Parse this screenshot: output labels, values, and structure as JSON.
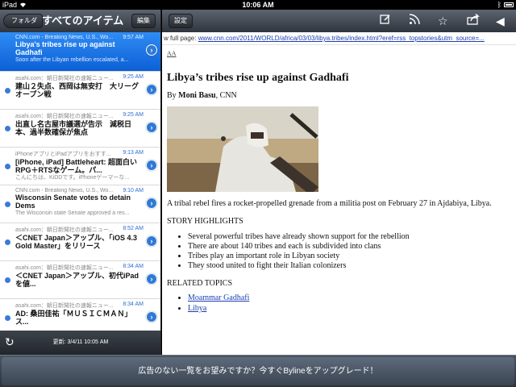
{
  "status_bar": {
    "carrier": "iPad",
    "time": "10:06 AM"
  },
  "left_pane": {
    "folder_button": "フォルダ",
    "title": "すべてのアイテム",
    "edit_button": "編集",
    "items": [
      {
        "source": "CNN.com - Breaking News, U.S., Wo...",
        "time": "9:57 AM",
        "title": "Libya's tribes rise up against Gadhafi",
        "snippet": "Soon after the Libyan rebellion escalated, a...",
        "selected": true
      },
      {
        "source": "asahi.com：朝日新聞社の速報ニュー...",
        "time": "9:25 AM",
        "title": "建山２失点、西岡は無安打　大リーグオープン戦",
        "snippet": ""
      },
      {
        "source": "asahi.com：朝日新聞社の速報ニュー...",
        "time": "9:25 AM",
        "title": "出直し名古屋市議選が告示　減税日本、過半数確保が焦点",
        "snippet": ""
      },
      {
        "source": "iPhoneアプリとiPadアプリをおすす...",
        "time": "9:13 AM",
        "title": "[iPhone, iPad] Battleheart: 超面白いRPG＋RTSなゲーム。パ...",
        "snippet": "こんにちは、KiDDです。iPhoneゲーマーな..."
      },
      {
        "source": "CNN.com - Breaking News, U.S., Wo...",
        "time": "9:10 AM",
        "title": "Wisconsin Senate votes to detain Dems",
        "snippet": "The Wisconsin state Senate approved a res..."
      },
      {
        "source": "asahi.com：朝日新聞社の速報ニュー...",
        "time": "8:52 AM",
        "title": "＜CNET Japan＞アップル、「iOS 4.3 Gold Master」をリリース",
        "snippet": ""
      },
      {
        "source": "asahi.com：朝日新聞社の速報ニュー...",
        "time": "8:34 AM",
        "title": "＜CNET Japan＞アップル、初代iPadを値...",
        "snippet": ""
      },
      {
        "source": "asahi.com：朝日新聞社の速報ニュー...",
        "time": "8:34 AM",
        "title": "AD: 桑田佳祐「ＭＵＳＩＣＭＡＮ」ス...",
        "snippet": ""
      }
    ],
    "updated": "更新: 3/4/11 10:05 AM"
  },
  "right_pane": {
    "settings_button": "設定",
    "url_prefix": "w full page: ",
    "url": "www.cnn.com/2011/WORLD/africa/03/03/libya.tribes/index.html?eref=rss_topstories&utm_source=...",
    "font_size_control": "AA",
    "article": {
      "headline": "Libya’s tribes rise up against Gadhafi",
      "byline_prefix": "By",
      "author": "Moni Basu",
      "byline_suffix": ", CNN",
      "caption": "A tribal rebel fires a rocket-propelled grenade from a militia post on February 27 in Ajdabiya, Libya.",
      "highlights_heading": "STORY HIGHLIGHTS",
      "highlights": [
        "Several powerful tribes have already shown support for the rebellion",
        "There are about 140 tribes and each is subdivided into clans",
        "Tribes play an important role in Libyan society",
        "They stood united to fight their Italian colonizers"
      ],
      "related_heading": "RELATED TOPICS",
      "related": [
        "Moammar Gadhafi",
        "Libya"
      ]
    }
  },
  "banner": {
    "text": "広告のない一覧をお望みですか？今すぐBylineをアップグレード！"
  },
  "colors": {
    "selected_row": "#1670e6",
    "link": "#1b3fb0",
    "toolbar": "#3a4149"
  }
}
